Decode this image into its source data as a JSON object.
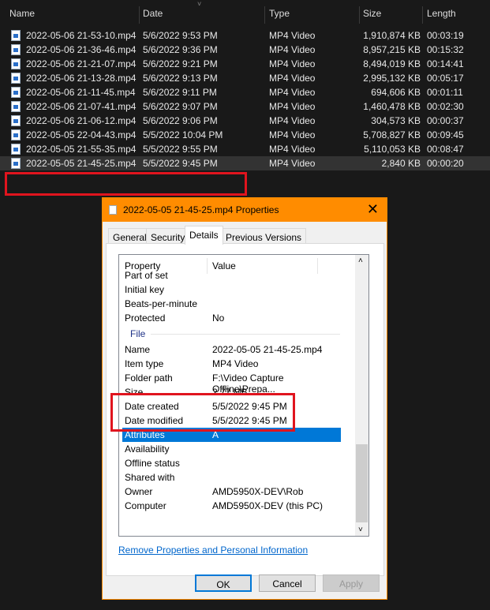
{
  "explorer": {
    "columns": [
      "Name",
      "Date",
      "Type",
      "Size",
      "Length"
    ],
    "files": [
      {
        "name": "2022-05-06 21-53-10.mp4",
        "date": "5/6/2022 9:53 PM",
        "type": "MP4 Video",
        "size": "1,910,874 KB",
        "length": "00:03:19"
      },
      {
        "name": "2022-05-06 21-36-46.mp4",
        "date": "5/6/2022 9:36 PM",
        "type": "MP4 Video",
        "size": "8,957,215 KB",
        "length": "00:15:32"
      },
      {
        "name": "2022-05-06 21-21-07.mp4",
        "date": "5/6/2022 9:21 PM",
        "type": "MP4 Video",
        "size": "8,494,019 KB",
        "length": "00:14:41"
      },
      {
        "name": "2022-05-06 21-13-28.mp4",
        "date": "5/6/2022 9:13 PM",
        "type": "MP4 Video",
        "size": "2,995,132 KB",
        "length": "00:05:17"
      },
      {
        "name": "2022-05-06 21-11-45.mp4",
        "date": "5/6/2022 9:11 PM",
        "type": "MP4 Video",
        "size": "694,606 KB",
        "length": "00:01:11"
      },
      {
        "name": "2022-05-06 21-07-41.mp4",
        "date": "5/6/2022 9:07 PM",
        "type": "MP4 Video",
        "size": "1,460,478 KB",
        "length": "00:02:30"
      },
      {
        "name": "2022-05-06 21-06-12.mp4",
        "date": "5/6/2022 9:06 PM",
        "type": "MP4 Video",
        "size": "304,573 KB",
        "length": "00:00:37"
      },
      {
        "name": "2022-05-05 22-04-43.mp4",
        "date": "5/5/2022 10:04 PM",
        "type": "MP4 Video",
        "size": "5,708,827 KB",
        "length": "00:09:45"
      },
      {
        "name": "2022-05-05 21-55-35.mp4",
        "date": "5/5/2022 9:55 PM",
        "type": "MP4 Video",
        "size": "5,110,053 KB",
        "length": "00:08:47"
      },
      {
        "name": "2022-05-05 21-45-25.mp4",
        "date": "5/5/2022 9:45 PM",
        "type": "MP4 Video",
        "size": "2,840 KB",
        "length": "00:00:20",
        "selected": true
      }
    ]
  },
  "dialog": {
    "title": "2022-05-05 21-45-25.mp4 Properties",
    "tabs": [
      "General",
      "Security",
      "Details",
      "Previous Versions"
    ],
    "active_tab": "Details",
    "col_property": "Property",
    "col_value": "Value",
    "section_file": "File",
    "rows_before": [
      {
        "p": "Part of set",
        "v": ""
      },
      {
        "p": "Initial key",
        "v": ""
      },
      {
        "p": "Beats-per-minute",
        "v": ""
      },
      {
        "p": "Protected",
        "v": "No"
      }
    ],
    "rows_file": [
      {
        "p": "Name",
        "v": "2022-05-05 21-45-25.mp4"
      },
      {
        "p": "Item type",
        "v": "MP4 Video"
      },
      {
        "p": "Folder path",
        "v": "F:\\Video Capture Offline\\Prepa..."
      },
      {
        "p": "Size",
        "v": "2.77 MB"
      },
      {
        "p": "Date created",
        "v": "5/5/2022 9:45 PM"
      },
      {
        "p": "Date modified",
        "v": "5/5/2022 9:45 PM"
      },
      {
        "p": "Attributes",
        "v": "A",
        "selected": true
      },
      {
        "p": "Availability",
        "v": ""
      },
      {
        "p": "Offline status",
        "v": ""
      },
      {
        "p": "Shared with",
        "v": ""
      },
      {
        "p": "Owner",
        "v": "AMD5950X-DEV\\Rob"
      },
      {
        "p": "Computer",
        "v": "AMD5950X-DEV (this PC)"
      }
    ],
    "link": "Remove Properties and Personal Information",
    "ok": "OK",
    "cancel": "Cancel",
    "apply": "Apply"
  },
  "colors": {
    "accent": "#ff8c00",
    "highlight": "#e0141e",
    "selection": "#0078d7"
  }
}
